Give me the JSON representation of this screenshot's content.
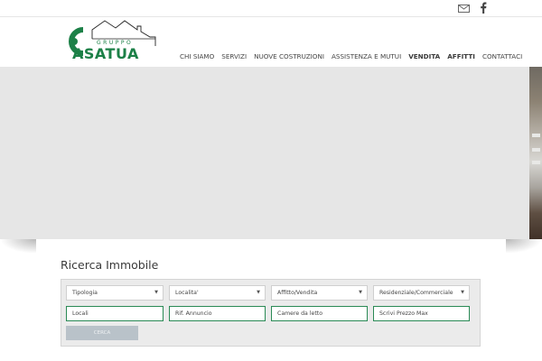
{
  "topbar": {
    "icons": [
      "mail-icon",
      "facebook-icon"
    ]
  },
  "logo": {
    "small_text": "GRUPPO",
    "wordmark": "ASATUA",
    "brand_color": "#1c8047"
  },
  "nav": {
    "items": [
      {
        "label": "CHI SIAMO"
      },
      {
        "label": "SERVIZI"
      },
      {
        "label": "NUOVE COSTRUZIONI"
      },
      {
        "label": "ASSISTENZA E MUTUI"
      },
      {
        "label": "VENDITA"
      },
      {
        "label": "AFFITTI"
      },
      {
        "label": "CONTATTACI"
      }
    ]
  },
  "search": {
    "title": "Ricerca Immobile",
    "selects": {
      "tipologia": "Tipologia",
      "localita": "Localita'",
      "contratto": "Affitto/Vendita",
      "categoria": "Residenziale/Commerciale"
    },
    "placeholders": {
      "locali": "Locali",
      "rif": "Rif. Annuncio",
      "camere": "Camere da letto",
      "prezzo": "Scrivi Prezzo Max"
    },
    "button_label": "CERCA",
    "accent_color": "#2a8a55"
  }
}
